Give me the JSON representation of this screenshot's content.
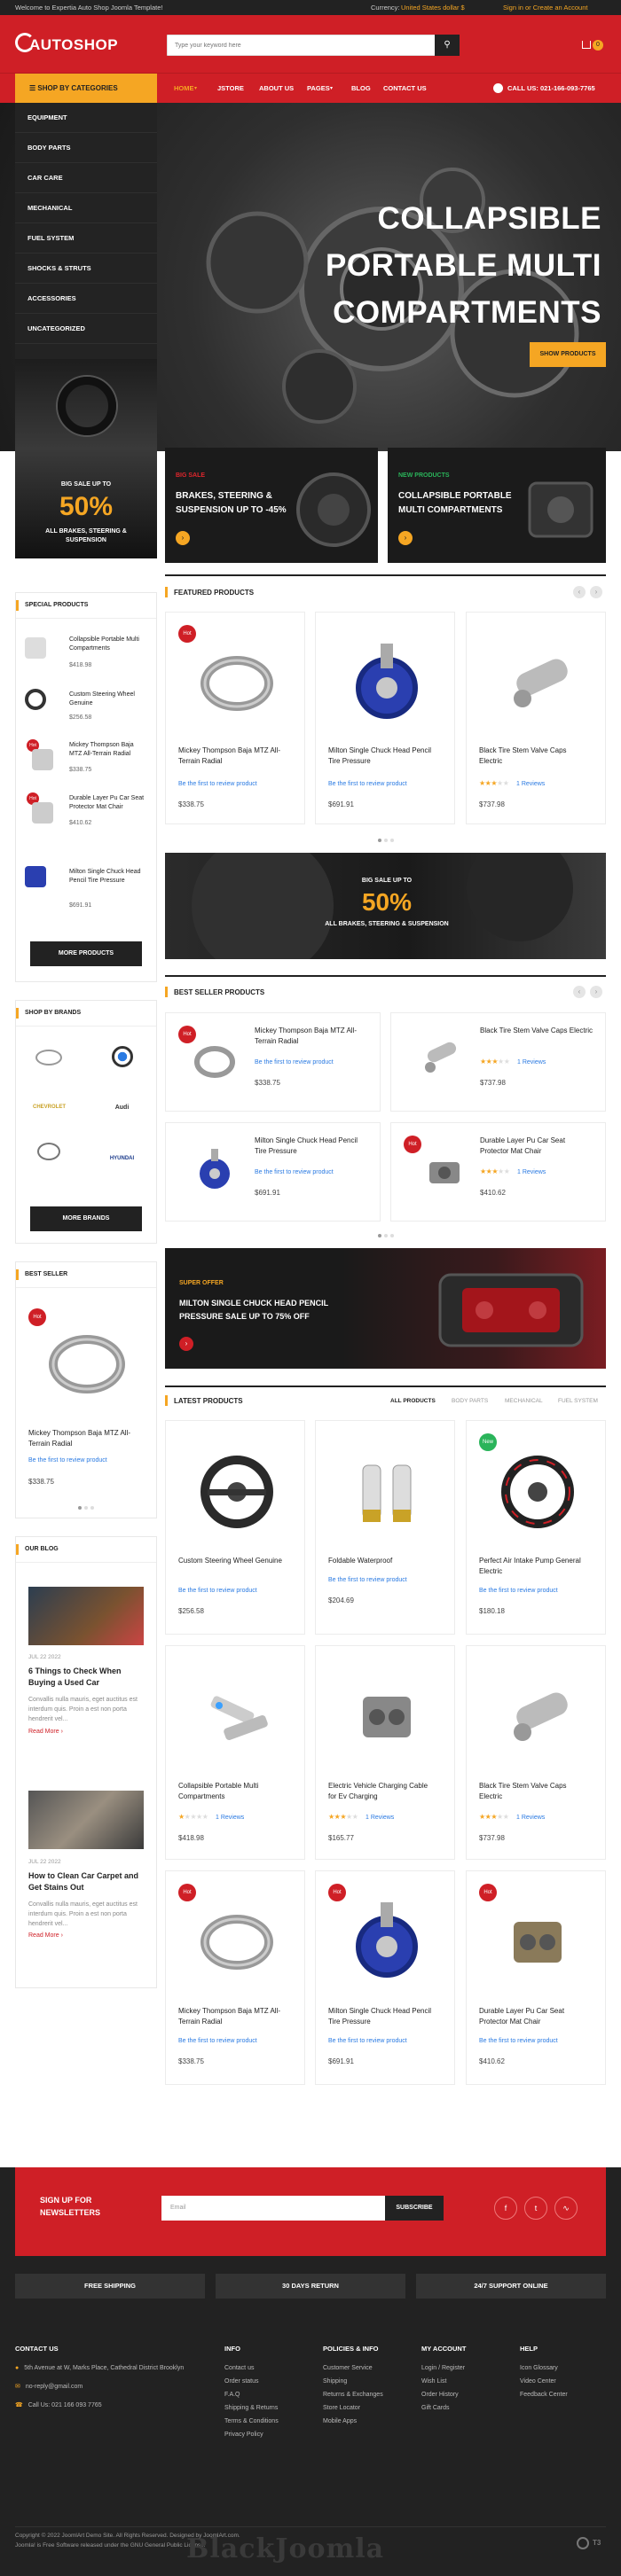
{
  "topbar": {
    "welcome": "Welcome to Expertia Auto Shop Joomla Template!",
    "currency_label": "Currency:",
    "currency_value": "United States dollar $",
    "signin": "Sign in or Create an Account"
  },
  "header": {
    "logo": "AUTOSHOP",
    "search_placeholder": "Type your keyword here",
    "cart_count": "0"
  },
  "nav": {
    "categories_btn": "SHOP BY CATEGORIES",
    "items": [
      "HOME",
      "JSTORE",
      "ABOUT US",
      "PAGES",
      "BLOG",
      "CONTACT US"
    ],
    "phone": "CALL US: 021-166-093-7765"
  },
  "categories": [
    "EQUIPMENT",
    "BODY PARTS",
    "CAR CARE",
    "MECHANICAL",
    "FUEL SYSTEM",
    "SHOCKS & STRUTS",
    "ACCESSORIES",
    "UNCATEGORIZED"
  ],
  "hero": {
    "title_lines": [
      "COLLAPSIBLE",
      "PORTABLE MULTI",
      "COMPARTMENTS"
    ],
    "button": "SHOW PRODUCTS"
  },
  "side_banner": {
    "small": "BIG SALE UP TO",
    "big": "50%",
    "caption": "ALL BRAKES, STEERING & SUSPENSION"
  },
  "promos": [
    {
      "tag": "BIG SALE",
      "text": "BRAKES, STEERING & SUSPENSION UP TO -45%",
      "tag_color": "#e0262c"
    },
    {
      "tag": "NEW PRODUCTS",
      "text": "COLLAPSIBLE PORTABLE MULTI COMPARTMENTS",
      "tag_color": "#2ab45a"
    }
  ],
  "special_products": {
    "heading": "SPECIAL PRODUCTS",
    "items": [
      {
        "name": "Collapsible Portable Multi Compartments",
        "price": "$418.98"
      },
      {
        "name": "Custom Steering Wheel Genuine",
        "price": "$256.58"
      },
      {
        "name": "Mickey Thompson Baja MTZ All-Terrain Radial",
        "price": "$338.75"
      },
      {
        "name": "Durable Layer Pu Car Seat Protector Mat Chair",
        "price": "$410.62"
      },
      {
        "name": "Milton Single Chuck Head Pencil Tire Pressure",
        "price": "$691.91"
      }
    ],
    "button": "MORE PRODUCTS"
  },
  "brands": {
    "heading": "SHOP BY BRANDS",
    "items": [
      "",
      "",
      "CHEVROLET",
      "Audi",
      "",
      "HYUNDAI"
    ],
    "button": "MORE BRANDS"
  },
  "best_seller_side": {
    "heading": "BEST SELLER",
    "badge": "Hot",
    "name": "Mickey Thompson Baja MTZ All-Terrain Radial",
    "review": "Be the first to review product",
    "price": "$338.75"
  },
  "blog": {
    "heading": "OUR BLOG",
    "posts": [
      {
        "date": "JUL 22 2022",
        "title": "6 Things to Check When Buying a Used Car",
        "excerpt": "Convallis nulla mauris, eget auctitus est interdum quis. Proin a est non porta hendrerit vel...",
        "more": "Read More"
      },
      {
        "date": "JUL 22 2022",
        "title": "How to Clean Car Carpet and Get Stains Out",
        "excerpt": "Convallis nulla mauris, eget auctitus est interdum quis. Proin a est non porta hendrerit vel...",
        "more": "Read More"
      }
    ]
  },
  "featured": {
    "heading": "FEATURED PRODUCTS",
    "items": [
      {
        "badge": "Hot",
        "name": "Mickey Thompson Baja MTZ All-Terrain Radial",
        "review": "Be the first to review product",
        "price": "$338.75"
      },
      {
        "badge": "",
        "name": "Milton Single Chuck Head Pencil Tire Pressure",
        "review": "Be the first to review product",
        "price": "$691.91"
      },
      {
        "badge": "",
        "name": "Black Tire Stem Valve Caps Electric",
        "review": "1 Reviews",
        "price": "$737.98"
      }
    ]
  },
  "mid_banner": {
    "small": "BIG SALE UP TO",
    "big": "50%",
    "caption": "ALL BRAKES, STEERING & SUSPENSION"
  },
  "best_seller": {
    "heading": "BEST SELLER PRODUCTS",
    "items": [
      {
        "badge": "Hot",
        "name": "Mickey Thompson Baja MTZ All-Terrain Radial",
        "review": "Be the first to review product",
        "price": "$338.75"
      },
      {
        "badge": "",
        "name": "Black Tire Stem Valve Caps Electric",
        "review": "1 Reviews",
        "price": "$737.98"
      },
      {
        "badge": "",
        "name": "Milton Single Chuck Head Pencil Tire Pressure",
        "review": "Be the first to review product",
        "price": "$691.91"
      },
      {
        "badge": "Hot",
        "name": "Durable Layer Pu Car Seat Protector Mat Chair",
        "review": "1 Reviews",
        "price": "$410.62"
      }
    ]
  },
  "super_banner": {
    "tag": "SUPER OFFER",
    "text": "MILTON SINGLE CHUCK HEAD PENCIL PRESSURE SALE UP TO 75% OFF"
  },
  "latest": {
    "heading": "LATEST PRODUCTS",
    "tabs": [
      "ALL PRODUCTS",
      "BODY PARTS",
      "MECHANICAL",
      "FUEL SYSTEM"
    ],
    "items": [
      {
        "badge": "",
        "name": "Custom Steering Wheel Genuine",
        "review": "Be the first to review product",
        "price": "$256.58"
      },
      {
        "badge": "",
        "name": "Foldable Waterproof",
        "review": "Be the first to review product",
        "price": "$204.69"
      },
      {
        "badge": "New",
        "name": "Perfect Air Intake Pump General Electric",
        "review": "Be the first to review product",
        "price": "$180.18"
      },
      {
        "badge": "",
        "name": "Collapsible Portable Multi Compartments",
        "review": "1 Reviews",
        "price": "$418.98"
      },
      {
        "badge": "",
        "name": "Electric Vehicle Charging Cable for Ev Charging",
        "review": "1 Reviews",
        "price": "$165.77"
      },
      {
        "badge": "",
        "name": "Black Tire Stem Valve Caps Electric",
        "review": "1 Reviews",
        "price": "$737.98"
      },
      {
        "badge": "Hot",
        "name": "Mickey Thompson Baja MTZ All-Terrain Radial",
        "review": "Be the first to review product",
        "price": "$338.75"
      },
      {
        "badge": "Hot",
        "name": "Milton Single Chuck Head Pencil Tire Pressure",
        "review": "Be the first to review product",
        "price": "$691.91"
      },
      {
        "badge": "Hot",
        "name": "Durable Layer Pu Car Seat Protector Mat Chair",
        "review": "Be the first to review product",
        "price": "$410.62"
      }
    ]
  },
  "newsletter": {
    "title": "SIGN UP FOR NEWSLETTERS",
    "placeholder": "Email",
    "button": "SUBSCRIBE"
  },
  "features": [
    "FREE SHIPPING",
    "30 DAYS RETURN",
    "24/7 SUPPORT ONLINE"
  ],
  "footer": {
    "contact": {
      "heading": "CONTACT US",
      "address": "5th Avenue at W, Marks Place, Cathedral District Brooklyn",
      "email": "no-reply@gmail.com",
      "phone": "Call Us: 021 166 093 7765"
    },
    "info": {
      "heading": "INFO",
      "links": [
        "Contact us",
        "Order status",
        "F.A.Q",
        "Shipping & Returns",
        "Terms & Conditions",
        "Privacy Policy"
      ]
    },
    "policies": {
      "heading": "POLICIES & INFO",
      "links": [
        "Customer Service",
        "Shipping",
        "Returns & Exchanges",
        "Store Locator",
        "Mobile Apps"
      ]
    },
    "account": {
      "heading": "MY ACCOUNT",
      "links": [
        "Login / Register",
        "Wish List",
        "Order History",
        "Gift Cards"
      ]
    },
    "help": {
      "heading": "HELP",
      "links": [
        "Icon Glossary",
        "Video Center",
        "Feedback Center"
      ]
    },
    "copyright": "Copyright © 2022 JoomlArt Demo Site. All Rights Reserved. Designed by JoomlArt.com.",
    "license": "Joomla! is Free Software released under the GNU General Public License.",
    "watermark": "BlackJoomla"
  },
  "colors": {
    "brand_red": "#cf1f26",
    "accent": "#f5a623"
  }
}
